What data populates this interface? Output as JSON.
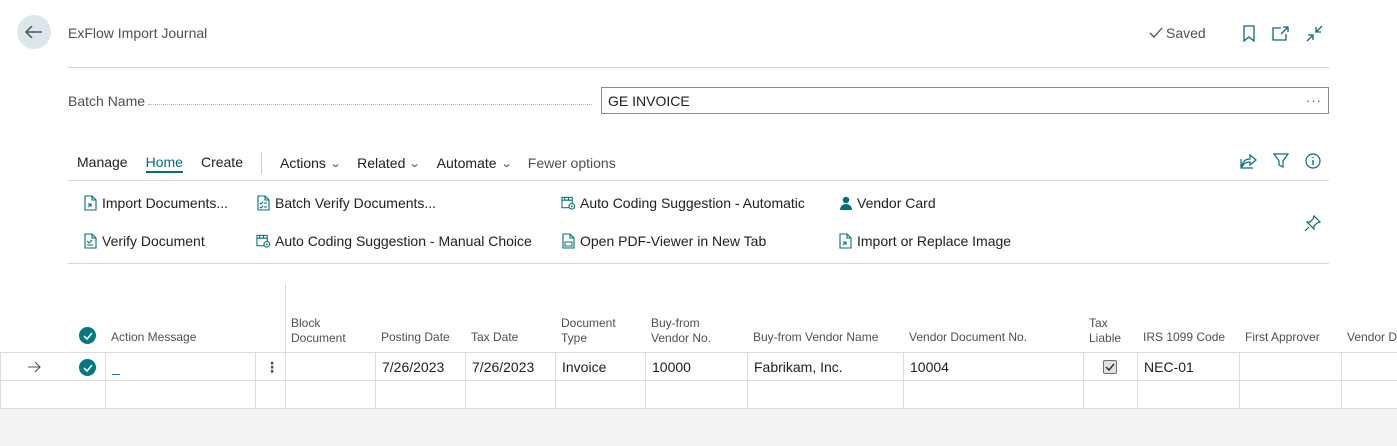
{
  "header": {
    "title": "ExFlow Import Journal",
    "saved_label": "Saved"
  },
  "batch": {
    "label": "Batch Name",
    "value": "GE INVOICE",
    "more": "···"
  },
  "action_bar": {
    "tabs": [
      "Manage",
      "Home",
      "Create"
    ],
    "active_tab": "Home",
    "menus": [
      "Actions",
      "Related",
      "Automate"
    ],
    "fewer_options": "Fewer options"
  },
  "actions": {
    "import_documents": "Import Documents...",
    "verify_document": "Verify Document",
    "batch_verify": "Batch Verify Documents...",
    "auto_coding_manual": "Auto Coding Suggestion - Manual Choice",
    "auto_coding_automatic": "Auto Coding Suggestion - Automatic",
    "open_pdf": "Open PDF-Viewer in New Tab",
    "vendor_card": "Vendor Card",
    "import_image": "Import or Replace Image"
  },
  "grid": {
    "headers": {
      "action_message": "Action Message",
      "block_document_1": "Block",
      "block_document_2": "Document",
      "posting_date": "Posting Date",
      "tax_date": "Tax Date",
      "document_type_1": "Document",
      "document_type_2": "Type",
      "buy_from_vendor_no_1": "Buy-from",
      "buy_from_vendor_no_2": "Vendor No.",
      "buy_from_vendor_name": "Buy-from Vendor Name",
      "vendor_document_no": "Vendor Document No.",
      "tax_liable_1": "Tax",
      "tax_liable_2": "Liable",
      "irs_1099_code": "IRS 1099 Code",
      "first_approver": "First Approver",
      "vendor_d": "Vendor D"
    },
    "row": {
      "action_message": "_",
      "posting_date": "7/26/2023",
      "tax_date": "7/26/2023",
      "document_type": "Invoice",
      "buy_from_vendor_no": "10000",
      "buy_from_vendor_name": "Fabrikam, Inc.",
      "vendor_document_no": "10004",
      "tax_liable": true,
      "irs_1099_code": "NEC-01"
    }
  },
  "colors": {
    "accent": "#00707a",
    "back_button_bg": "#dbe7ea",
    "status_check": "#007a85"
  }
}
